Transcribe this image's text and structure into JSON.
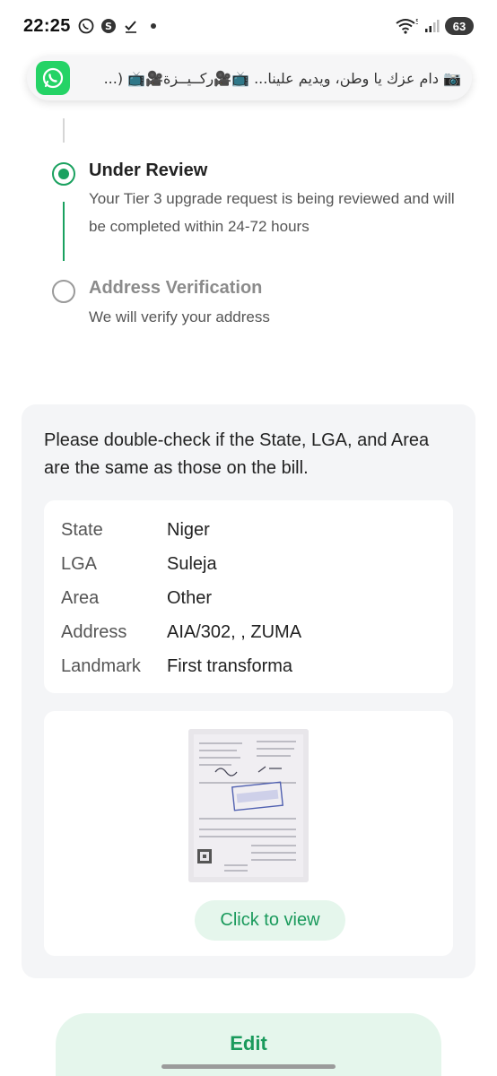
{
  "status_bar": {
    "time": "22:25",
    "battery": "63",
    "left_icons": [
      "whatsapp-icon",
      "s-app-icon",
      "checkmark-icon",
      "dot-icon"
    ],
    "right_icons": [
      "wifi-icon",
      "signal-icon",
      "battery-icon"
    ]
  },
  "notification": {
    "text": "📷 دام عزك يا وطن، ويديم علينا... 📺🎥ركــيــزة🎥📺 (...",
    "icon": "whatsapp-icon",
    "accent": "#25d366"
  },
  "timeline": {
    "steps": [
      {
        "title": "Under Review",
        "description": "Your Tier 3 upgrade request is being reviewed and will be completed within 24-72 hours",
        "state": "active"
      },
      {
        "title": "Address Verification",
        "description": "We will verify your address",
        "state": "pending"
      }
    ],
    "accent": "#1aa15f"
  },
  "card": {
    "intro": "Please double-check if the State, LGA, and Area are the same as those on the bill.",
    "fields": [
      {
        "label": "State",
        "value": "Niger"
      },
      {
        "label": "LGA",
        "value": "Suleja"
      },
      {
        "label": "Area",
        "value": "Other"
      },
      {
        "label": "Address",
        "value": "AIA/302, , ZUMA"
      },
      {
        "label": "Landmark",
        "value": "First transforma"
      }
    ],
    "view_button": "Click to view"
  },
  "edit_button": "Edit"
}
